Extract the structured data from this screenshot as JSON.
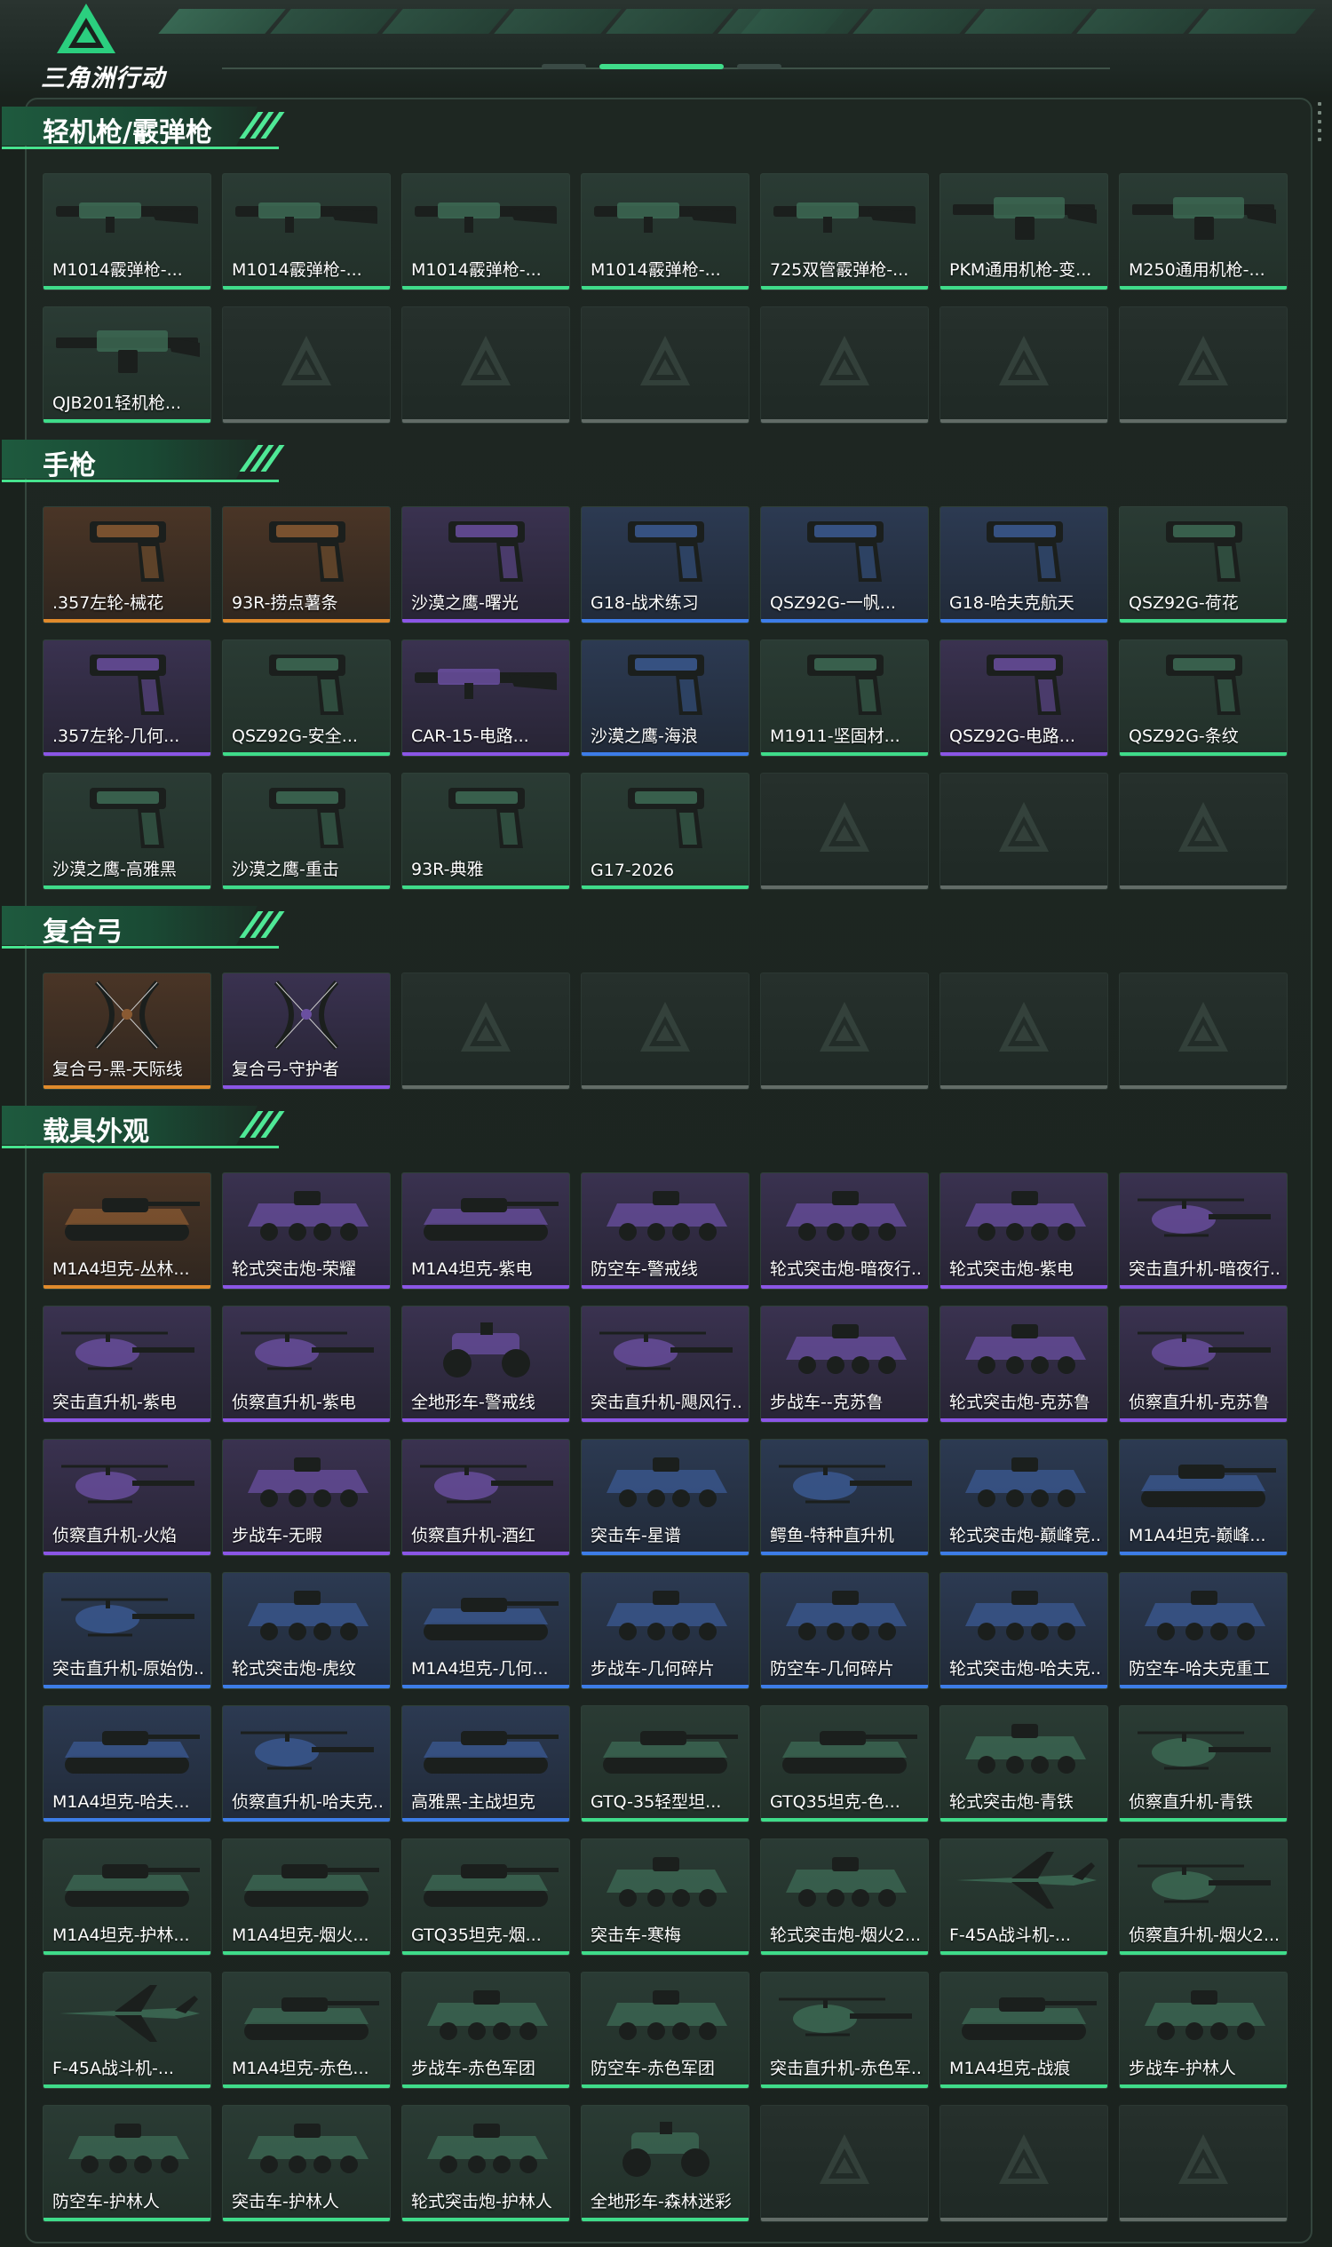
{
  "app": {
    "logo_text": "三角洲行动"
  },
  "colors": {
    "green": "#3fdc8a",
    "orange": "#e08a2c",
    "blue": "#3d7de8",
    "purple": "#8b56e6",
    "gray": "#8f9a94"
  },
  "sections": [
    {
      "title": "轻机枪/霰弹枪",
      "items": [
        {
          "name": "M1014霰弹枪-...",
          "rarity": "green",
          "icon": "shotgun-icon"
        },
        {
          "name": "M1014霰弹枪-...",
          "rarity": "green",
          "icon": "shotgun-icon"
        },
        {
          "name": "M1014霰弹枪-...",
          "rarity": "green",
          "icon": "shotgun-icon"
        },
        {
          "name": "M1014霰弹枪-...",
          "rarity": "green",
          "icon": "shotgun-icon"
        },
        {
          "name": "725双管霰弹枪-...",
          "rarity": "green",
          "icon": "shotgun-icon"
        },
        {
          "name": "PKM通用机枪-变...",
          "rarity": "green",
          "icon": "machine-gun-icon"
        },
        {
          "name": "M250通用机枪-...",
          "rarity": "green",
          "icon": "machine-gun-icon"
        },
        {
          "name": "QJB201轻机枪...",
          "rarity": "green",
          "icon": "machine-gun-icon"
        },
        {
          "empty": true
        },
        {
          "empty": true
        },
        {
          "empty": true
        },
        {
          "empty": true
        },
        {
          "empty": true
        },
        {
          "empty": true
        }
      ]
    },
    {
      "title": "手枪",
      "items": [
        {
          "name": ".357左轮-械花",
          "rarity": "orange",
          "icon": "revolver-icon"
        },
        {
          "name": "93R-捞点薯条",
          "rarity": "orange",
          "icon": "pistol-icon"
        },
        {
          "name": "沙漠之鹰-曙光",
          "rarity": "purple",
          "icon": "pistol-icon"
        },
        {
          "name": "G18-战术练习",
          "rarity": "blue",
          "icon": "pistol-icon"
        },
        {
          "name": "QSZ92G-一帆...",
          "rarity": "blue",
          "icon": "pistol-icon"
        },
        {
          "name": "G18-哈夫克航天",
          "rarity": "blue",
          "icon": "pistol-icon"
        },
        {
          "name": "QSZ92G-荷花",
          "rarity": "green",
          "icon": "pistol-icon"
        },
        {
          "name": ".357左轮-几何...",
          "rarity": "purple",
          "icon": "revolver-icon"
        },
        {
          "name": "QSZ92G-安全...",
          "rarity": "green",
          "icon": "pistol-icon"
        },
        {
          "name": "CAR-15-电路...",
          "rarity": "purple",
          "icon": "rifle-icon"
        },
        {
          "name": "沙漠之鹰-海浪",
          "rarity": "blue",
          "icon": "pistol-icon"
        },
        {
          "name": "M1911-坚固材...",
          "rarity": "green",
          "icon": "pistol-icon"
        },
        {
          "name": "QSZ92G-电路...",
          "rarity": "purple",
          "icon": "pistol-icon"
        },
        {
          "name": "QSZ92G-条纹",
          "rarity": "green",
          "icon": "pistol-icon"
        },
        {
          "name": "沙漠之鹰-高雅黑",
          "rarity": "green",
          "icon": "pistol-icon"
        },
        {
          "name": "沙漠之鹰-重击",
          "rarity": "green",
          "icon": "pistol-icon"
        },
        {
          "name": "93R-典雅",
          "rarity": "green",
          "icon": "pistol-icon"
        },
        {
          "name": "G17-2026",
          "rarity": "green",
          "icon": "pistol-icon"
        },
        {
          "empty": true
        },
        {
          "empty": true
        },
        {
          "empty": true
        }
      ]
    },
    {
      "title": "复合弓",
      "items": [
        {
          "name": "复合弓-黑-天际线",
          "rarity": "orange",
          "icon": "bow-icon"
        },
        {
          "name": "复合弓-守护者",
          "rarity": "purple",
          "icon": "bow-icon"
        },
        {
          "empty": true
        },
        {
          "empty": true
        },
        {
          "empty": true
        },
        {
          "empty": true
        },
        {
          "empty": true
        }
      ]
    },
    {
      "title": "载具外观",
      "items": [
        {
          "name": "M1A4坦克-丛林...",
          "rarity": "orange",
          "icon": "tank-icon"
        },
        {
          "name": "轮式突击炮-荣耀",
          "rarity": "purple",
          "icon": "armored-car-icon"
        },
        {
          "name": "M1A4坦克-紫电",
          "rarity": "purple",
          "icon": "tank-icon"
        },
        {
          "name": "防空车-警戒线",
          "rarity": "purple",
          "icon": "armored-car-icon"
        },
        {
          "name": "轮式突击炮-暗夜行...",
          "rarity": "purple",
          "icon": "armored-car-icon"
        },
        {
          "name": "轮式突击炮-紫电",
          "rarity": "purple",
          "icon": "armored-car-icon"
        },
        {
          "name": "突击直升机-暗夜行...",
          "rarity": "purple",
          "icon": "helicopter-icon"
        },
        {
          "name": "突击直升机-紫电",
          "rarity": "purple",
          "icon": "helicopter-icon"
        },
        {
          "name": "侦察直升机-紫电",
          "rarity": "purple",
          "icon": "helicopter-icon"
        },
        {
          "name": "全地形车-警戒线",
          "rarity": "purple",
          "icon": "atv-icon"
        },
        {
          "name": "突击直升机-飓风行...",
          "rarity": "purple",
          "icon": "helicopter-icon"
        },
        {
          "name": "步战车--克苏鲁",
          "rarity": "purple",
          "icon": "armored-car-icon"
        },
        {
          "name": "轮式突击炮-克苏鲁",
          "rarity": "purple",
          "icon": "armored-car-icon"
        },
        {
          "name": "侦察直升机-克苏鲁",
          "rarity": "purple",
          "icon": "helicopter-icon"
        },
        {
          "name": "侦察直升机-火焰",
          "rarity": "purple",
          "icon": "helicopter-icon"
        },
        {
          "name": "步战车-无暇",
          "rarity": "purple",
          "icon": "armored-car-icon"
        },
        {
          "name": "侦察直升机-酒红",
          "rarity": "purple",
          "icon": "helicopter-icon"
        },
        {
          "name": "突击车-星谱",
          "rarity": "blue",
          "icon": "armored-car-icon"
        },
        {
          "name": "鳄鱼-特种直升机",
          "rarity": "blue",
          "icon": "helicopter-icon"
        },
        {
          "name": "轮式突击炮-巅峰竞...",
          "rarity": "blue",
          "icon": "armored-car-icon"
        },
        {
          "name": "M1A4坦克-巅峰...",
          "rarity": "blue",
          "icon": "tank-icon"
        },
        {
          "name": "突击直升机-原始伪...",
          "rarity": "blue",
          "icon": "helicopter-icon"
        },
        {
          "name": "轮式突击炮-虎纹",
          "rarity": "blue",
          "icon": "armored-car-icon"
        },
        {
          "name": "M1A4坦克-几何...",
          "rarity": "blue",
          "icon": "tank-icon"
        },
        {
          "name": "步战车-几何碎片",
          "rarity": "blue",
          "icon": "armored-car-icon"
        },
        {
          "name": "防空车-几何碎片",
          "rarity": "blue",
          "icon": "armored-car-icon"
        },
        {
          "name": "轮式突击炮-哈夫克...",
          "rarity": "blue",
          "icon": "armored-car-icon"
        },
        {
          "name": "防空车-哈夫克重工",
          "rarity": "blue",
          "icon": "armored-car-icon"
        },
        {
          "name": "M1A4坦克-哈夫...",
          "rarity": "blue",
          "icon": "tank-icon"
        },
        {
          "name": "侦察直升机-哈夫克...",
          "rarity": "blue",
          "icon": "helicopter-icon"
        },
        {
          "name": "高雅黑-主战坦克",
          "rarity": "blue",
          "icon": "tank-icon"
        },
        {
          "name": "GTQ-35轻型坦...",
          "rarity": "green",
          "icon": "tank-icon"
        },
        {
          "name": "GTQ35坦克-色...",
          "rarity": "green",
          "icon": "tank-icon"
        },
        {
          "name": "轮式突击炮-青铁",
          "rarity": "green",
          "icon": "armored-car-icon"
        },
        {
          "name": "侦察直升机-青铁",
          "rarity": "green",
          "icon": "helicopter-icon"
        },
        {
          "name": "M1A4坦克-护林...",
          "rarity": "green",
          "icon": "tank-icon"
        },
        {
          "name": "M1A4坦克-烟火...",
          "rarity": "green",
          "icon": "tank-icon"
        },
        {
          "name": "GTQ35坦克-烟...",
          "rarity": "green",
          "icon": "tank-icon"
        },
        {
          "name": "突击车-寒梅",
          "rarity": "green",
          "icon": "armored-car-icon"
        },
        {
          "name": "轮式突击炮-烟火2...",
          "rarity": "green",
          "icon": "armored-car-icon"
        },
        {
          "name": "F-45A战斗机-...",
          "rarity": "green",
          "icon": "jet-icon"
        },
        {
          "name": "侦察直升机-烟火2...",
          "rarity": "green",
          "icon": "helicopter-icon"
        },
        {
          "name": "F-45A战斗机-...",
          "rarity": "green",
          "icon": "jet-icon"
        },
        {
          "name": "M1A4坦克-赤色...",
          "rarity": "green",
          "icon": "tank-icon"
        },
        {
          "name": "步战车-赤色军团",
          "rarity": "green",
          "icon": "armored-car-icon"
        },
        {
          "name": "防空车-赤色军团",
          "rarity": "green",
          "icon": "armored-car-icon"
        },
        {
          "name": "突击直升机-赤色军...",
          "rarity": "green",
          "icon": "helicopter-icon"
        },
        {
          "name": "M1A4坦克-战痕",
          "rarity": "green",
          "icon": "tank-icon"
        },
        {
          "name": "步战车-护林人",
          "rarity": "green",
          "icon": "armored-car-icon"
        },
        {
          "name": "防空车-护林人",
          "rarity": "green",
          "icon": "armored-car-icon"
        },
        {
          "name": "突击车-护林人",
          "rarity": "green",
          "icon": "armored-car-icon"
        },
        {
          "name": "轮式突击炮-护林人",
          "rarity": "green",
          "icon": "armored-car-icon"
        },
        {
          "name": "全地形车-森林迷彩",
          "rarity": "green",
          "icon": "atv-icon"
        },
        {
          "empty": true
        },
        {
          "empty": true
        },
        {
          "empty": true
        }
      ]
    }
  ]
}
